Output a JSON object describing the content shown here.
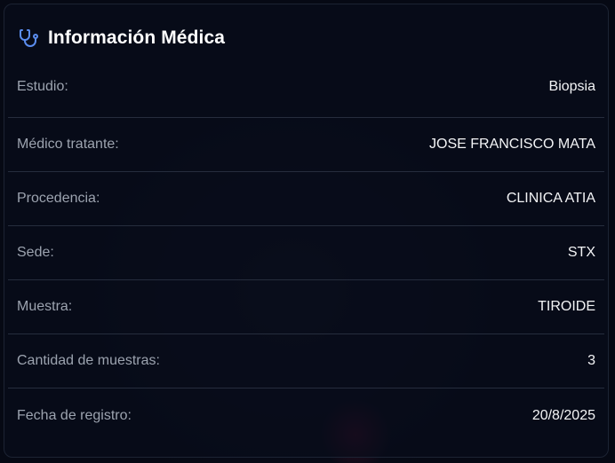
{
  "card": {
    "title": "Información Médica",
    "icon": "stethoscope-icon",
    "accent_color": "#5b8def",
    "rows": [
      {
        "label": "Estudio:",
        "value": "Biopsia"
      },
      {
        "label": "Médico tratante:",
        "value": "JOSE FRANCISCO MATA"
      },
      {
        "label": "Procedencia:",
        "value": "CLINICA ATIA"
      },
      {
        "label": "Sede:",
        "value": "STX"
      },
      {
        "label": "Muestra:",
        "value": "TIROIDE"
      },
      {
        "label": "Cantidad de muestras:",
        "value": "3"
      },
      {
        "label": "Fecha de registro:",
        "value": "20/8/2025"
      }
    ]
  }
}
